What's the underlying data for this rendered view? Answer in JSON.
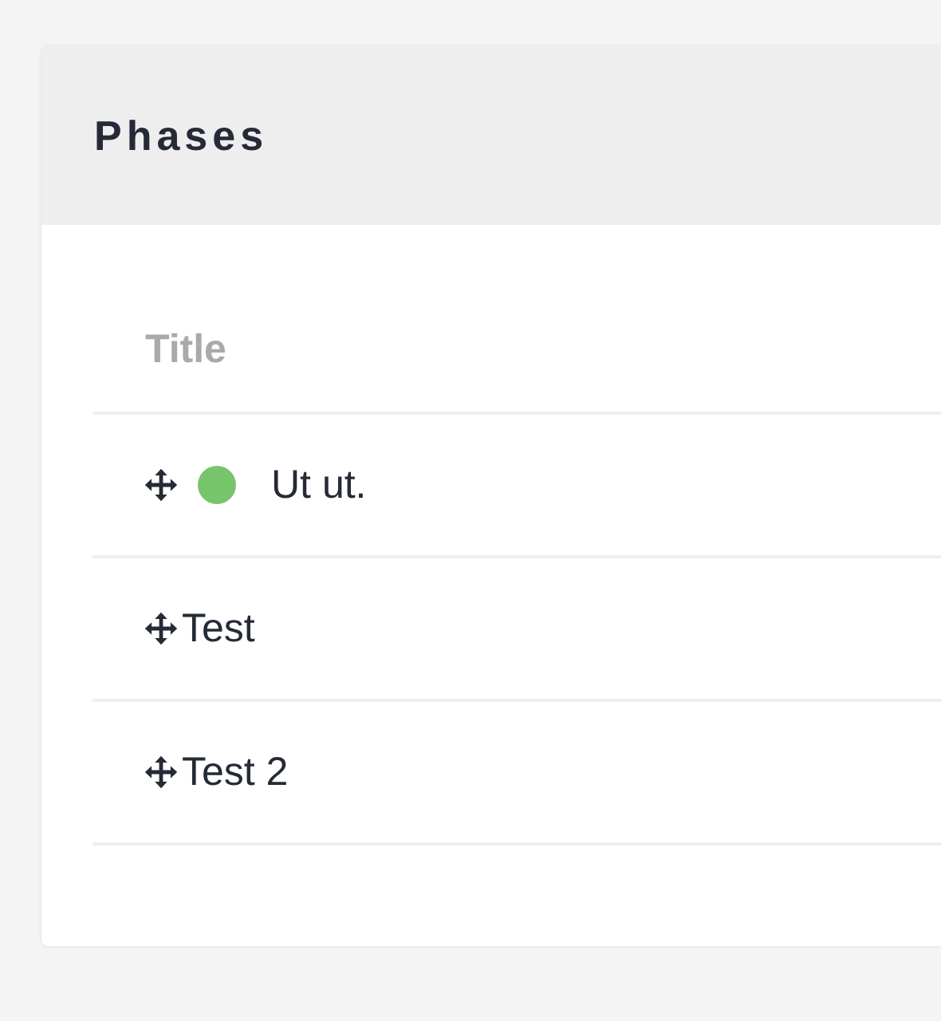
{
  "panel": {
    "title": "Phases"
  },
  "table": {
    "columns": [
      "Title"
    ],
    "rows": [
      {
        "title": "Ut ut.",
        "color": "#78c46c"
      },
      {
        "title": "Test"
      },
      {
        "title": "Test 2"
      }
    ]
  }
}
